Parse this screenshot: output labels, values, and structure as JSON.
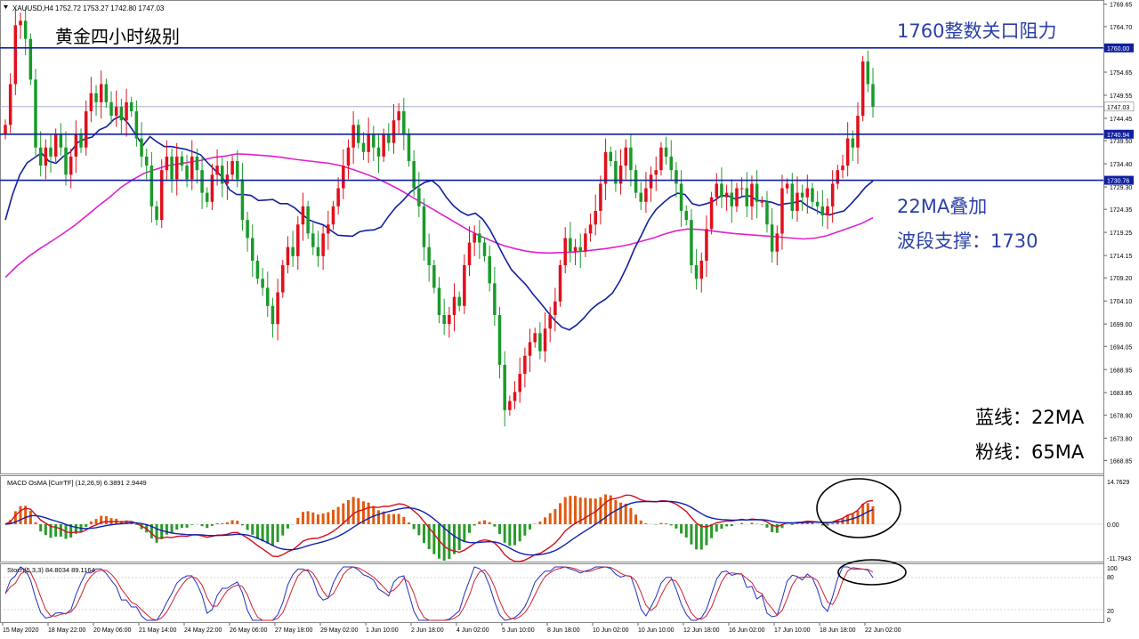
{
  "chart_data": {
    "type": "candlestick",
    "symbol_line": "XAUUSD,H4  1752.72 1753.27 1742.80 1747.03",
    "title": "黄金四小时级别",
    "annotations": {
      "resistance": "1760整数关口阻力",
      "support_line1": "22MA叠加",
      "support_line2": "波段支撑：1730",
      "legend_blue": "蓝线：22MA",
      "legend_pink": "粉线：65MA"
    },
    "colors": {
      "up": "#e0101c",
      "down": "#1a9a2a",
      "ma22": "#1020a0",
      "ma65": "#e020d0",
      "hline": "#1020a0"
    },
    "price_axis": {
      "min": 1666.0,
      "max": 1769.6
    },
    "y_ticks": [
      "1769.65",
      "1764.70",
      "1759.75",
      "1754.65",
      "1749.55",
      "1744.45",
      "1739.50",
      "1734.40",
      "1729.30",
      "1724.35",
      "1719.25",
      "1714.15",
      "1709.20",
      "1704.10",
      "1699.00",
      "1694.05",
      "1688.95",
      "1683.85",
      "1678.90",
      "1673.80",
      "1668.85"
    ],
    "horizontal_lines": [
      {
        "price": 1760.0,
        "label": "1760.00"
      },
      {
        "price": 1740.94,
        "label": "1740.94"
      },
      {
        "price": 1730.76,
        "label": "1730.76"
      }
    ],
    "current_price": {
      "price": 1747.03,
      "label": "1747.03"
    },
    "x_labels": [
      "15 May 2020",
      "18 May 22:00",
      "20 May 06:00",
      "21 May 14:00",
      "24 May 22:00",
      "26 May 06:00",
      "27 May 18:00",
      "29 May 02:00",
      "1 Jun 10:00",
      "2 Jun 18:00",
      "4 Jun 02:00",
      "5 Jun 10:00",
      "8 Jun 18:00",
      "10 Jun 02:00",
      "10 Jun 10:00",
      "12 Jun 18:00",
      "16 Jun 02:00",
      "17 Jun 10:00",
      "18 Jun 18:00",
      "22 Jun 02:00"
    ],
    "closes": [
      1743,
      1752,
      1765,
      1766,
      1762,
      1753,
      1738,
      1734,
      1738,
      1736,
      1741,
      1738,
      1732,
      1736,
      1741,
      1738,
      1746,
      1750,
      1748,
      1752,
      1748,
      1745,
      1747,
      1744,
      1748,
      1746,
      1740,
      1736,
      1734,
      1725,
      1722,
      1733,
      1736,
      1731,
      1736,
      1734,
      1731,
      1736,
      1733,
      1728,
      1726,
      1732,
      1734,
      1730,
      1732,
      1735,
      1731,
      1722,
      1718,
      1713,
      1709,
      1707,
      1703,
      1699,
      1706,
      1712,
      1716,
      1714,
      1721,
      1725,
      1719,
      1716,
      1714,
      1719,
      1721,
      1725,
      1729,
      1734,
      1738,
      1743,
      1739,
      1737,
      1741,
      1738,
      1736,
      1741,
      1739,
      1744,
      1746,
      1741,
      1735,
      1729,
      1725,
      1716,
      1712,
      1707,
      1701,
      1699,
      1701,
      1705,
      1703,
      1712,
      1717,
      1719,
      1717,
      1714,
      1708,
      1701,
      1690,
      1680,
      1682,
      1684,
      1688,
      1692,
      1695,
      1697,
      1693,
      1698,
      1701,
      1704,
      1712,
      1718,
      1715,
      1716,
      1715,
      1719,
      1721,
      1724,
      1730,
      1737,
      1735,
      1730,
      1734,
      1738,
      1733,
      1728,
      1726,
      1729,
      1732,
      1733,
      1738,
      1736,
      1733,
      1730,
      1724,
      1722,
      1712,
      1709,
      1713,
      1720,
      1727,
      1730,
      1727,
      1728,
      1725,
      1729,
      1729,
      1725,
      1730,
      1726,
      1726,
      1721,
      1715,
      1719,
      1729,
      1730,
      1724,
      1728,
      1727,
      1729,
      1726,
      1725,
      1723,
      1725,
      1730,
      1733,
      1734,
      1740,
      1738,
      1745,
      1757,
      1752,
      1747
    ],
    "ma22": [
      1722.0,
      1727.6,
      1732.0,
      1734.6,
      1735.7,
      1736.8,
      1735.0,
      1734.5,
      1736.0,
      1737.0,
      1739.1,
      1739.9,
      1740.3,
      1741.9,
      1742.6,
      1744.2,
      1745.0,
      1743.3,
      1740.9,
      1738.4,
      1740.4,
      1739.2,
      1738.2,
      1738.2,
      1737.9,
      1737.6,
      1737.0,
      1736.4,
      1734.6,
      1733.0,
      1731.5,
      1728.7,
      1727.6,
      1727.6,
      1727.4,
      1726.3,
      1726.4,
      1726.5,
      1725.6,
      1725.6,
      1724.7,
      1723.3,
      1722.0,
      1721.4,
      1720.9,
      1719.7,
      1718.6,
      1718.5,
      1718.4,
      1719.4,
      1719.7,
      1719.8,
      1720.5,
      1722.8,
      1724.8,
      1726.3,
      1728.1,
      1729.3,
      1730.3,
      1730.7,
      1729.4,
      1727.0,
      1725.1,
      1723.8,
      1723.0,
      1723.5,
      1722.2,
      1719.9,
      1716.9,
      1713.8,
      1711.0,
      1709.3,
      1707.7,
      1705.6,
      1703.7,
      1701.7,
      1699.8,
      1698.3,
      1697.7,
      1698.8,
      1700.3,
      1702.2,
      1703.5,
      1704.5,
      1705.9,
      1708.5,
      1711.8,
      1715.6,
      1718.7,
      1722.0,
      1724.3,
      1725.8,
      1727.1,
      1727.9,
      1727.6,
      1725.6,
      1725.2,
      1725.6,
      1726.2,
      1727.4,
      1727.3,
      1726.6,
      1727.2,
      1727.3,
      1726.3,
      1726.2,
      1725.9,
      1725.3,
      1725.6,
      1725.8,
      1726.2,
      1725.0,
      1724.2,
      1723.4,
      1723.1,
      1723.6,
      1724.0,
      1725.6,
      1727.4,
      1729.3,
      1730.6
    ],
    "ma65": [
      1709.3,
      1711.8,
      1713.9,
      1715.7,
      1717.3,
      1719.0,
      1720.8,
      1722.9,
      1725.0,
      1727.0,
      1729.2,
      1730.9,
      1732.3,
      1733.2,
      1734.0,
      1734.4,
      1734.8,
      1735.2,
      1735.8,
      1736.1,
      1736.6,
      1736.5,
      1736.3,
      1736.1,
      1735.8,
      1735.4,
      1735.1,
      1734.8,
      1734.5,
      1734.0,
      1733.2,
      1732.3,
      1731.3,
      1730.1,
      1728.8,
      1727.3,
      1725.8,
      1724.3,
      1722.8,
      1721.3,
      1719.8,
      1718.5,
      1717.4,
      1716.4,
      1715.7,
      1715.1,
      1714.8,
      1714.7,
      1714.8,
      1714.9,
      1715.1,
      1715.4,
      1715.7,
      1716.1,
      1716.6,
      1717.3,
      1718.0,
      1718.9,
      1719.6,
      1720.0,
      1719.9,
      1719.6,
      1719.3,
      1719.0,
      1718.8,
      1718.6,
      1718.4,
      1718.2,
      1718.0,
      1717.8,
      1718.0,
      1718.5,
      1719.4,
      1720.3,
      1721.2,
      1722.5
    ]
  },
  "indicators": {
    "macd_label": "MACD OsMA [CurrTF] (12,26,9) 6.3891 2.9449",
    "macd_ticks": [
      "14.7629",
      "0.00",
      "-11.7943"
    ],
    "stoch_label": "Stoch(5,3,3) 84.8034 89.1164",
    "stoch_ticks": [
      "100",
      "80",
      "20",
      "0"
    ]
  }
}
